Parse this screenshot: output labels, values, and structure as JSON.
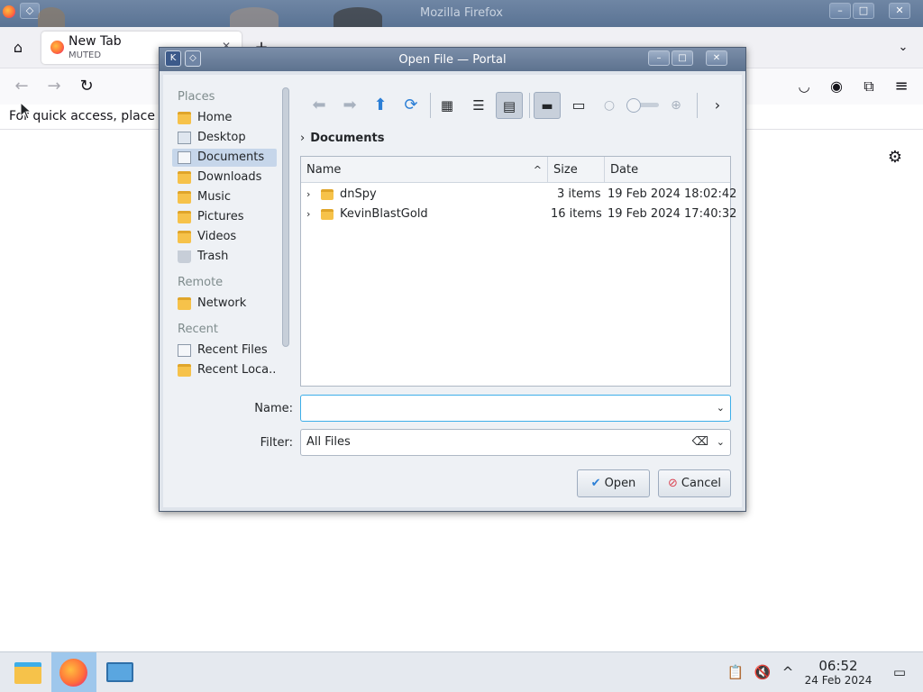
{
  "firefox": {
    "window_title": "Mozilla Firefox",
    "tab": {
      "title": "New Tab",
      "status": "MUTED"
    },
    "newtab_message": "For quick access, place yo",
    "min": "–",
    "max": "□",
    "close": "✕",
    "new_tab_button": "+",
    "tab_close": "✕"
  },
  "dialog": {
    "title": "Open File — Portal",
    "places": {
      "heading_places": "Places",
      "items": [
        "Home",
        "Desktop",
        "Documents",
        "Downloads",
        "Music",
        "Pictures",
        "Videos",
        "Trash"
      ],
      "heading_remote": "Remote",
      "remote_items": [
        "Network"
      ],
      "heading_recent": "Recent",
      "recent_items": [
        "Recent Files",
        "Recent Loca..."
      ]
    },
    "breadcrumb": "Documents",
    "columns": {
      "name": "Name",
      "size": "Size",
      "date": "Date"
    },
    "files": [
      {
        "name": "dnSpy",
        "size": "3 items",
        "date": "19 Feb 2024 18:02:42"
      },
      {
        "name": "KevinBlastGold",
        "size": "16 items",
        "date": "19 Feb 2024 17:40:32"
      }
    ],
    "name_label": "Name:",
    "name_value": "",
    "filter_label": "Filter:",
    "filter_value": "All Files",
    "open_button": "Open",
    "cancel_button": "Cancel"
  },
  "taskbar": {
    "time": "06:52",
    "date": "24 Feb 2024"
  }
}
